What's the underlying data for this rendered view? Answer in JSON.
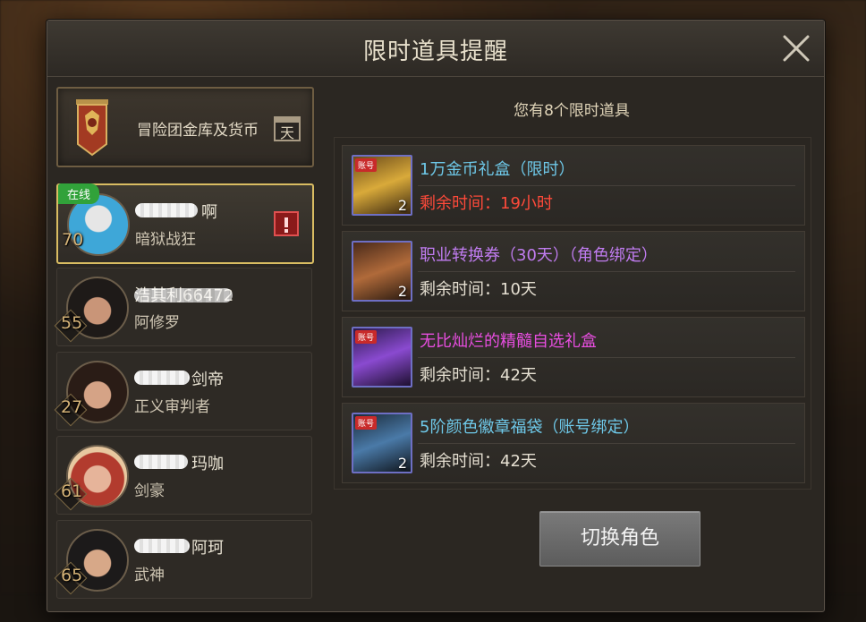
{
  "dialog": {
    "title": "限时道具提醒",
    "close_icon": "close-icon"
  },
  "guild": {
    "label": "冒险团金库及货币",
    "emblem_icon": "guild-banner-icon",
    "calendar_char": "天"
  },
  "characters": [
    {
      "level": "70",
      "name_partial": "啊",
      "class": "暗狱战狂",
      "online_label": "在线",
      "active": true
    },
    {
      "level": "55",
      "name_partial": "浩其利66472",
      "class": "阿修罗",
      "active": false
    },
    {
      "level": "27",
      "name_partial": "剑帝",
      "class": "正义审判者",
      "active": false
    },
    {
      "level": "61",
      "name_partial": "玛咖",
      "class": "剑豪",
      "active": false
    },
    {
      "level": "65",
      "name_partial": "阿珂",
      "class": "武神",
      "active": false
    }
  ],
  "summary": {
    "count_text": "您有8个限时道具"
  },
  "items": [
    {
      "name": "1万金币礼盒（限时）",
      "remaining": "剩余时间：19小时",
      "qty": "2",
      "name_color": "#6ec8e8",
      "remaining_color": "#ff4a3a",
      "tag": "账号",
      "icon": "gold-chest-icon"
    },
    {
      "name": "职业转换券（30天）（角色绑定）",
      "remaining": "剩余时间：10天",
      "qty": "2",
      "name_color": "#c07cf0",
      "remaining_color": "#e6e0d2",
      "icon": "scroll-gear-icon"
    },
    {
      "name": "无比灿烂的精髓自选礼盒",
      "remaining": "剩余时间：42天",
      "qty": "",
      "name_color": "#e84ee0",
      "remaining_color": "#e6e0d2",
      "tag": "账号",
      "icon": "purple-chest-icon"
    },
    {
      "name": "5阶颜色徽章福袋（账号绑定）",
      "remaining": "剩余时间：42天",
      "qty": "2",
      "name_color": "#6ec8e8",
      "remaining_color": "#e6e0d2",
      "tag": "账号",
      "icon": "emblem-pouch-icon"
    }
  ],
  "switch_button": {
    "label": "切换角色"
  }
}
